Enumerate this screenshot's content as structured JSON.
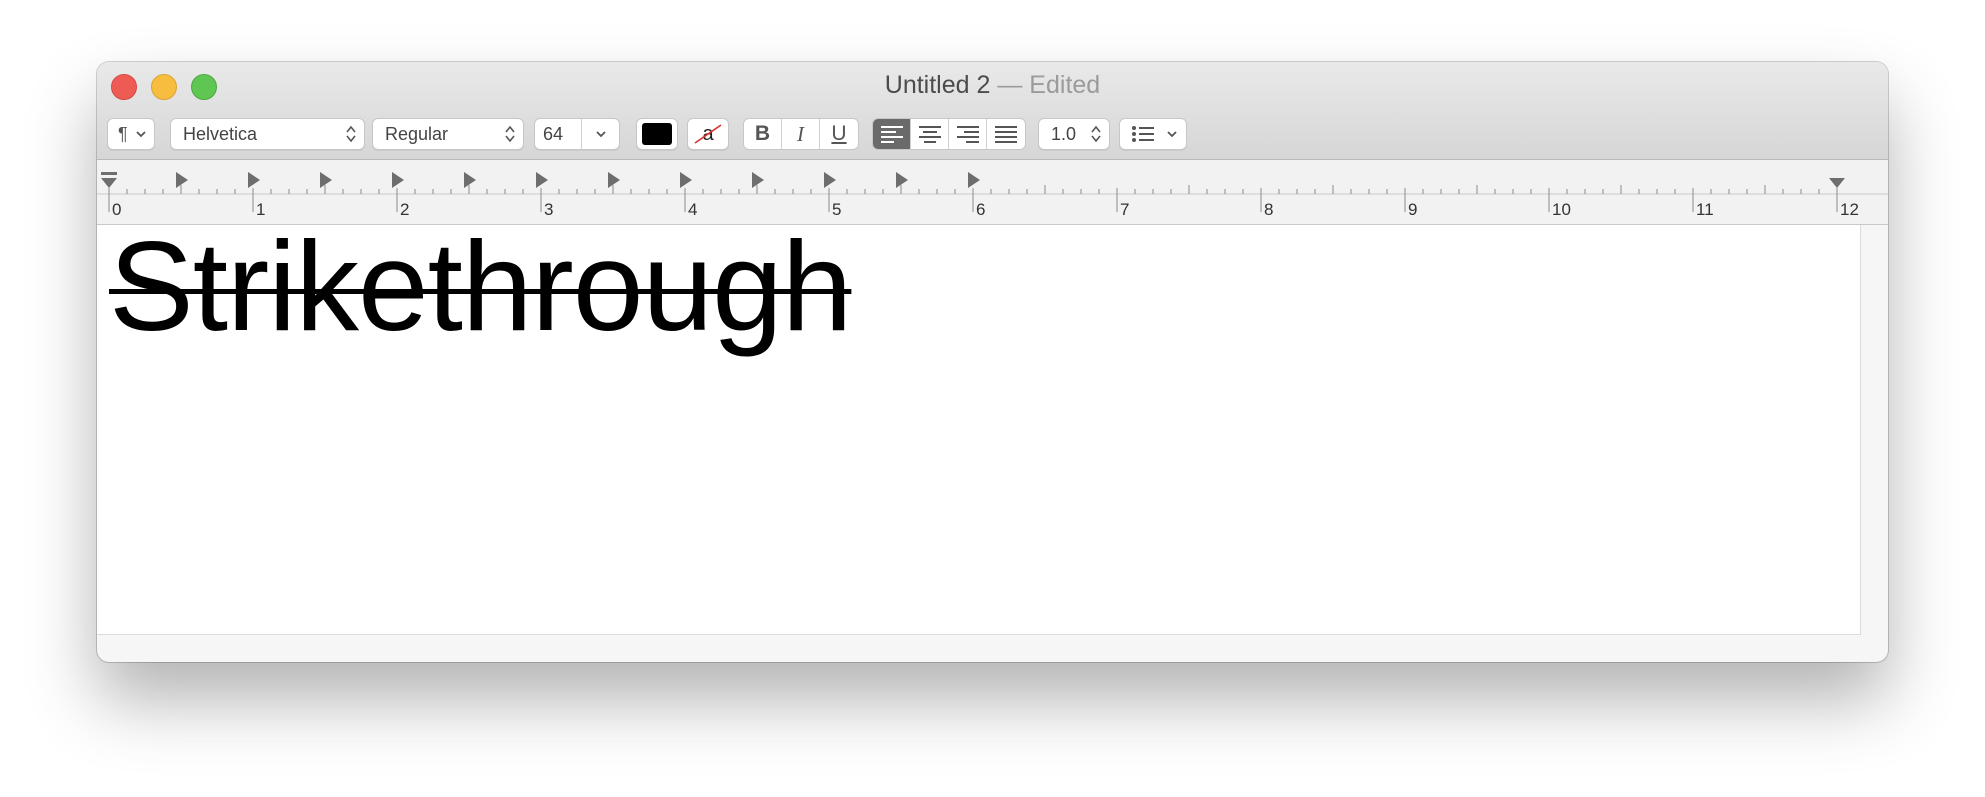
{
  "window": {
    "title": "Untitled 2",
    "status": "— Edited"
  },
  "toolbar": {
    "paragraph_symbol": "¶",
    "font_family": "Helvetica",
    "font_style": "Regular",
    "font_size": "64",
    "line_spacing": "1.0",
    "bold_label": "B",
    "italic_label": "I",
    "underline_label": "U",
    "text_color": "#000000",
    "highlight_glyph": "a",
    "alignment_selected": "left"
  },
  "ruler": {
    "numbers": [
      "0",
      "1",
      "2",
      "3",
      "4",
      "5",
      "6",
      "7",
      "8",
      "9",
      "10",
      "11",
      "12"
    ]
  },
  "document": {
    "text": "Strikethrough"
  }
}
